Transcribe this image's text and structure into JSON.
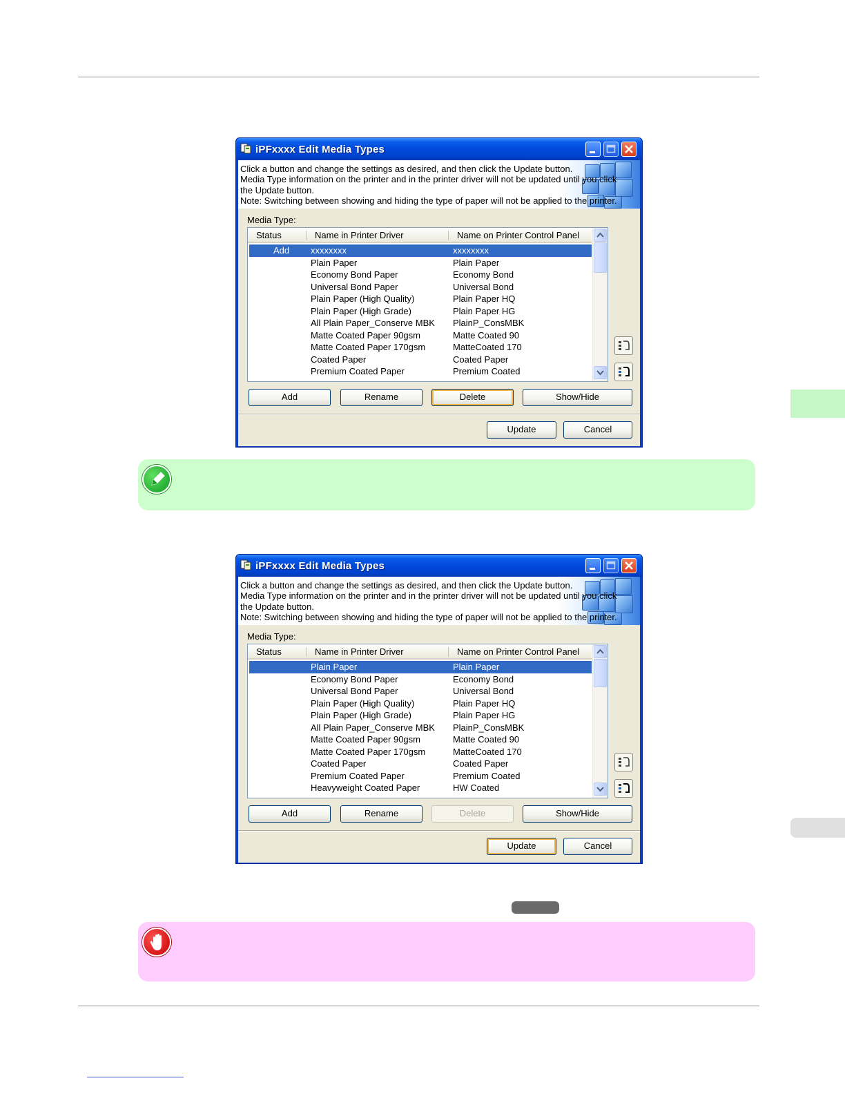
{
  "dialogs": [
    {
      "title": "iPFxxxx Edit Media Types",
      "banner_text": "Click a button and change the settings as desired, and then click the Update button.\nMedia Type information on the printer and in the printer driver will not be updated until you click\nthe Update button.\nNote: Switching between showing and hiding the type of paper will not be applied to the printer.",
      "media_type_label": "Media Type:",
      "columns": [
        "Status",
        "Name in Printer Driver",
        "Name on Printer Control Panel"
      ],
      "rows": [
        {
          "status": "Add",
          "driver": "xxxxxxxx",
          "panel": "xxxxxxxx"
        },
        {
          "status": "",
          "driver": "Plain Paper",
          "panel": "Plain Paper"
        },
        {
          "status": "",
          "driver": "Economy Bond Paper",
          "panel": "Economy Bond"
        },
        {
          "status": "",
          "driver": "Universal Bond Paper",
          "panel": "Universal Bond"
        },
        {
          "status": "",
          "driver": "Plain Paper (High Quality)",
          "panel": "Plain Paper HQ"
        },
        {
          "status": "",
          "driver": "Plain Paper (High Grade)",
          "panel": "Plain Paper HG"
        },
        {
          "status": "",
          "driver": "All Plain Paper_Conserve MBK",
          "panel": "PlainP_ConsMBK"
        },
        {
          "status": "",
          "driver": "Matte Coated Paper 90gsm",
          "panel": "Matte Coated 90"
        },
        {
          "status": "",
          "driver": "Matte Coated Paper 170gsm",
          "panel": "MatteCoated 170"
        },
        {
          "status": "",
          "driver": "Coated Paper",
          "panel": "Coated Paper"
        },
        {
          "status": "",
          "driver": "Premium Coated Paper",
          "panel": "Premium Coated"
        }
      ],
      "buttons": {
        "add": "Add",
        "rename": "Rename",
        "delete": "Delete",
        "showhide": "Show/Hide",
        "update": "Update",
        "cancel": "Cancel"
      }
    },
    {
      "title": "iPFxxxx Edit Media Types",
      "banner_text": "Click a button and change the settings as desired, and then click the Update button.\nMedia Type information on the printer and in the printer driver will not be updated until you click\nthe Update button.\nNote: Switching between showing and hiding the type of paper will not be applied to the printer.",
      "media_type_label": "Media Type:",
      "columns": [
        "Status",
        "Name in Printer Driver",
        "Name on Printer Control Panel"
      ],
      "rows": [
        {
          "status": "",
          "driver": "Plain Paper",
          "panel": "Plain Paper"
        },
        {
          "status": "",
          "driver": "Economy Bond Paper",
          "panel": "Economy Bond"
        },
        {
          "status": "",
          "driver": "Universal Bond Paper",
          "panel": "Universal Bond"
        },
        {
          "status": "",
          "driver": "Plain Paper (High Quality)",
          "panel": "Plain Paper HQ"
        },
        {
          "status": "",
          "driver": "Plain Paper (High Grade)",
          "panel": "Plain Paper HG"
        },
        {
          "status": "",
          "driver": "All Plain Paper_Conserve MBK",
          "panel": "PlainP_ConsMBK"
        },
        {
          "status": "",
          "driver": "Matte Coated Paper 90gsm",
          "panel": "Matte Coated 90"
        },
        {
          "status": "",
          "driver": "Matte Coated Paper 170gsm",
          "panel": "MatteCoated 170"
        },
        {
          "status": "",
          "driver": "Coated Paper",
          "panel": "Coated Paper"
        },
        {
          "status": "",
          "driver": "Premium Coated Paper",
          "panel": "Premium Coated"
        },
        {
          "status": "",
          "driver": "Heavyweight Coated Paper",
          "panel": "HW Coated"
        }
      ],
      "buttons": {
        "add": "Add",
        "rename": "Rename",
        "delete": "Delete",
        "showhide": "Show/Hide",
        "update": "Update",
        "cancel": "Cancel"
      }
    }
  ],
  "icons": {
    "note": "pencil-note-icon",
    "important": "stop-hand-icon",
    "title_app": "printer-app-icon",
    "scroll_up": "chevron-up-icon",
    "scroll_down": "chevron-down-icon",
    "move_up": "move-up-icon",
    "move_down": "move-down-icon"
  },
  "colors": {
    "note_bg": "#ccffcc",
    "important_bg": "#ffccff",
    "selection": "#316ac5",
    "titlebar": "#0148d8"
  }
}
